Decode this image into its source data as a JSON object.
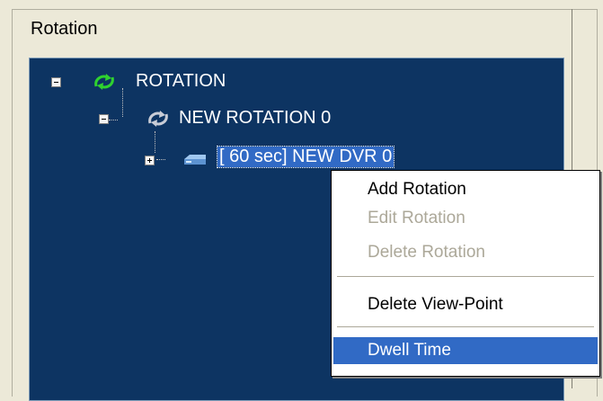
{
  "group": {
    "title": "Rotation"
  },
  "tree": {
    "root": {
      "label": "ROTATION",
      "icon": "rotation-green-icon",
      "expanded": true
    },
    "child": {
      "label": "NEW ROTATION 0",
      "icon": "rotation-gray-icon",
      "expanded": true
    },
    "grandchild": {
      "label": "[  60 sec] NEW DVR 0",
      "icon": "dvr-device-icon",
      "expanded": false,
      "selected": true
    }
  },
  "context_menu": {
    "items": [
      {
        "label": "Add Rotation",
        "enabled": true
      },
      {
        "label": "Edit Rotation",
        "enabled": false
      },
      {
        "label": "Delete Rotation",
        "enabled": false
      },
      {
        "label": "Delete View-Point",
        "enabled": true
      },
      {
        "label": "Dwell Time",
        "enabled": true,
        "highlighted": true
      }
    ]
  },
  "colors": {
    "tree_background": "#0d3462",
    "selection": "#316ac5",
    "window_background": "#ece9d8",
    "disabled_text": "#aca899"
  }
}
